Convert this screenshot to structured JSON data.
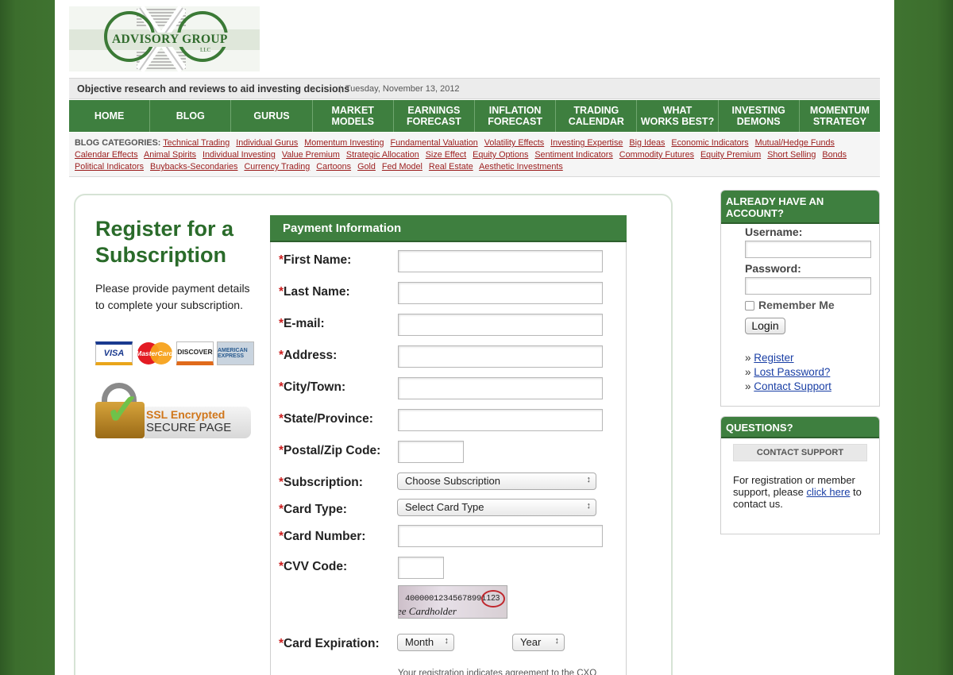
{
  "brand": {
    "name": "ADVISORY GROUP",
    "llc": "LLC"
  },
  "tagline": {
    "text": "Objective research and reviews to aid investing decisions",
    "date": "Tuesday, November 13, 2012"
  },
  "nav": [
    "HOME",
    "BLOG",
    "GURUS",
    "MARKET\nMODELS",
    "EARNINGS\nFORECAST",
    "INFLATION\nFORECAST",
    "TRADING\nCALENDAR",
    "WHAT\nWORKS BEST?",
    "INVESTING\nDEMONS",
    "MOMENTUM\nSTRATEGY"
  ],
  "categories": {
    "label": "BLOG CATEGORIES:",
    "items": [
      "Technical Trading",
      "Individual Gurus",
      "Momentum Investing",
      "Fundamental Valuation",
      "Volatility Effects",
      "Investing Expertise",
      "Big Ideas",
      "Economic Indicators",
      "Mutual/Hedge Funds",
      "Calendar Effects",
      "Animal Spirits",
      "Individual Investing",
      "Value Premium",
      "Strategic Allocation",
      "Size Effect",
      "Equity Options",
      "Sentiment Indicators",
      "Commodity Futures",
      "Equity Premium",
      "Short Selling",
      "Bonds",
      "Political Indicators",
      "Buybacks-Secondaries",
      "Currency Trading",
      "Cartoons",
      "Gold",
      "Fed Model",
      "Real Estate",
      "Aesthetic Investments"
    ]
  },
  "register": {
    "title_line1": "Register for a",
    "title_line2": "Subscription",
    "description": "Please provide payment details to complete your subscription.",
    "cards": [
      "VISA",
      "MasterCard",
      "DISCOVER",
      "AMERICAN EXPRESS"
    ],
    "ssl_line1": "SSL Encrypted",
    "ssl_line2": "SECURE PAGE"
  },
  "payment": {
    "header": "Payment Information",
    "required_mark": "*",
    "fields": {
      "first_name": "First Name:",
      "last_name": "Last Name:",
      "email": "E-mail:",
      "address": "Address:",
      "city": "City/Town:",
      "state": "State/Province:",
      "postal": "Postal/Zip Code:",
      "subscription": "Subscription:",
      "card_type": "Card Type:",
      "card_number": "Card Number:",
      "cvv": "CVV Code:",
      "expiration": "Card Expiration:"
    },
    "subscription_value": "Choose Subscription",
    "card_type_value": "Select Card Type",
    "month_value": "Month",
    "year_value": "Year",
    "cvv_sample_number": "40000012345678991",
    "cvv_sample_code": "123",
    "cvv_sample_sig": "ee Cardholder",
    "terms_text": "Your registration indicates agreement to the CXO"
  },
  "account": {
    "header": "ALREADY HAVE AN ACCOUNT?",
    "username_label": "Username:",
    "password_label": "Password:",
    "remember_label": "Remember Me",
    "login_label": "Login",
    "bullet": "»",
    "links": [
      "Register",
      "Lost Password?",
      "Contact Support"
    ]
  },
  "questions": {
    "header": "QUESTIONS?",
    "button": "CONTACT SUPPORT",
    "text_before": "For registration or member support, please ",
    "link": "click here",
    "text_after": " to contact us."
  },
  "colors": {
    "brand_green": "#3e7f3f",
    "link_red": "#9b1c1c",
    "link_blue": "#1a3fa5",
    "required": "#cc1f1f"
  }
}
